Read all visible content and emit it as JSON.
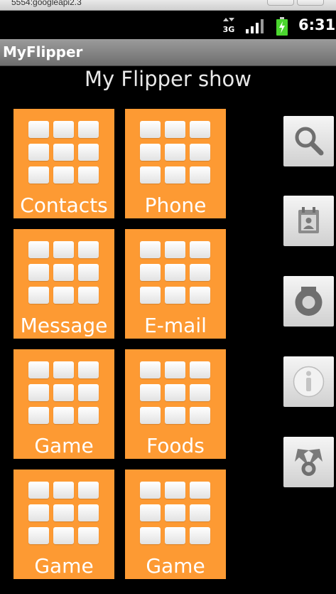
{
  "emulator": {
    "window_text": "5554:googleapi2.3"
  },
  "status_bar": {
    "time": "6:31",
    "network": "3G"
  },
  "app": {
    "title": "MyFlipper",
    "heading": "My Flipper show"
  },
  "tiles": [
    {
      "label": "Contacts"
    },
    {
      "label": "Phone"
    },
    {
      "label": "Message"
    },
    {
      "label": "E-mail"
    },
    {
      "label": "Game"
    },
    {
      "label": "Foods"
    },
    {
      "label": "Game"
    },
    {
      "label": "Game"
    }
  ],
  "side_buttons": [
    {
      "icon": "search-icon"
    },
    {
      "icon": "calendar-contact-icon"
    },
    {
      "icon": "settings-gear-icon"
    },
    {
      "icon": "info-icon"
    },
    {
      "icon": "share-icon"
    }
  ],
  "colors": {
    "tile": "#fd9a33",
    "background": "#000000",
    "battery": "#4bd62f"
  }
}
